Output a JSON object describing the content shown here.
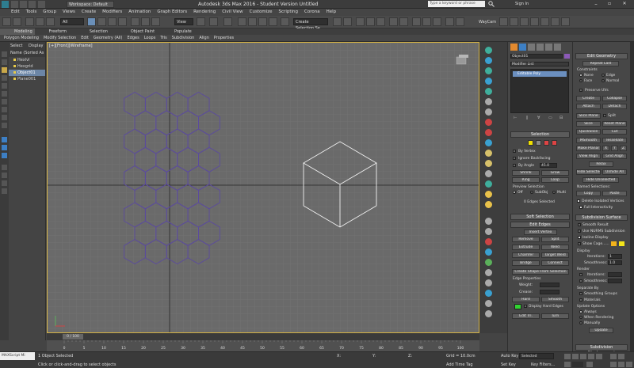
{
  "window": {
    "workspace": "Workspace: Default",
    "title": "Autodesk 3ds Max 2016 - Student Version    Untitled",
    "search_placeholder": "Type a keyword or phrase",
    "signin": "Sign In"
  },
  "menu": [
    "Edit",
    "Tools",
    "Group",
    "Views",
    "Create",
    "Modifiers",
    "Animation",
    "Graph Editors",
    "Rendering",
    "Civil View",
    "Customize",
    "Scripting",
    "Corona",
    "Help"
  ],
  "toolbar": {
    "filter": "All",
    "view": "View",
    "selset": "Create Selection Se",
    "render_label": "WayCam"
  },
  "ribbon_tabs": [
    "Modeling",
    "Freeform",
    "Selection",
    "Object Paint",
    "Populate"
  ],
  "ribbon_tools": [
    "Polygon Modeling",
    "Modify Selection",
    "Edit",
    "Geometry (All)",
    "Edges",
    "Loops",
    "Tris",
    "Subdivision",
    "Align",
    "Properties"
  ],
  "scene_explorer": {
    "tabs": [
      "Select",
      "Display"
    ],
    "header": "Name (Sorted As",
    "items": [
      {
        "name": "Hexlvl",
        "selected": false
      },
      {
        "name": "Hexgrid",
        "selected": false
      },
      {
        "name": "Object01",
        "selected": true
      },
      {
        "name": "Plane001",
        "selected": false
      }
    ]
  },
  "viewport": {
    "label": "[+][Front][Wireframe]"
  },
  "timeline": {
    "frame": "0 / 100"
  },
  "ticks": [
    "0",
    "5",
    "10",
    "15",
    "20",
    "25",
    "30",
    "35",
    "40",
    "45",
    "50",
    "55",
    "60",
    "65",
    "70",
    "75",
    "80",
    "85",
    "90",
    "95",
    "100"
  ],
  "status": {
    "message": "1 Object Selected",
    "prompt": "Click or click-and-drag to select objects",
    "maxscript": "MAXScript Mi",
    "x": "X:",
    "y": "Y:",
    "z": "Z:",
    "grid": "Grid = 10.0cm",
    "autokey": "Auto Key",
    "setkey": "Set Key",
    "selected": "Selected",
    "keyfilters": "Key Filters...",
    "addtimetag": "Add Time Tag"
  },
  "modifier_panel": {
    "object_name": "Object01",
    "modifier_list": "Modifier List",
    "stack_item": "Editable Poly",
    "selection_title": "Selection",
    "by_vertex": "By Vertex",
    "ignore_backfacing": "Ignore Backfacing",
    "by_angle": "By Angle",
    "angle_value": "45.0",
    "shrink": "Shrink",
    "grow": "Grow",
    "ring": "Ring",
    "loop": "Loop",
    "preview_selection": "Preview Selection",
    "off": "Off",
    "subobj": "SubObj",
    "multi": "Multi",
    "edges_selected": "0 Edges Selected",
    "soft_selection": "Soft Selection",
    "edit_edges": "Edit Edges",
    "insert_vertex": "Insert Vertex",
    "remove": "Remove",
    "split": "Split",
    "extrude": "Extrude",
    "weld": "Weld",
    "chamfer": "Chamfer",
    "target_weld": "Target Weld",
    "bridge": "Bridge",
    "connect": "Connect",
    "create_shape": "Create Shape From Selection",
    "edge_properties": "Edge Properties",
    "weight": "Weight:",
    "crease": "Crease:",
    "hard": "Hard",
    "smooth": "Smooth",
    "display_hard_edges": "Display Hard Edges",
    "edit_tri": "Edit Tri.",
    "turn": "Turn"
  },
  "edit_panel": {
    "edit_geometry": "Edit Geometry",
    "repeat_last": "Repeat Last",
    "constraints": "Constraints",
    "none": "None",
    "edge": "Edge",
    "face": "Face",
    "normal": "Normal",
    "preserve_uvs": "Preserve UVs",
    "create": "Create",
    "collapse": "Collapse",
    "attach": "Attach",
    "detach": "Detach",
    "slice_plane": "Slice Plane",
    "split": "Split",
    "slice": "Slice",
    "reset_plane": "Reset Plane",
    "quickslice": "QuickSlice",
    "cut": "Cut",
    "msmooth": "MSmooth",
    "tessellate": "Tessellate",
    "make_planar": "Make Planar",
    "x": "X",
    "y": "Y",
    "z": "Z",
    "view_align": "View Align",
    "grid_align": "Grid Align",
    "relax": "Relax",
    "hide_selected": "Hide Selected",
    "unhide_all": "Unhide All",
    "hide_unselected": "Hide Unselected",
    "named_selections": "Named Selections:",
    "copy": "Copy",
    "paste": "Paste",
    "delete_isolated": "Delete Isolated Vertices",
    "full_interactivity": "Full Interactivity",
    "subdivision_surface": "Subdivision Surface",
    "smooth_result": "Smooth Result",
    "use_nurms": "Use NURMS Subdivision",
    "isoline": "Isoline Display",
    "show_cage": "Show Cage......",
    "display": "Display",
    "iterations": "Iterations:",
    "iter_val": "1",
    "smoothness": "Smoothness:",
    "smooth_val": "1.0",
    "render": "Render",
    "separate_by": "Separate By",
    "smoothing_groups": "Smoothing Groups",
    "materials": "Materials",
    "update_options": "Update Options",
    "always": "Always",
    "when_rendering": "When Rendering",
    "manually": "Manually",
    "update": "Update",
    "subdiv_displacement": "Subdivision Displacement"
  },
  "colors": {
    "viewport_bg": "#6a6a6a",
    "hex_stroke": "#5b4a9e",
    "cube_stroke": "#f0f0f0",
    "active_border": "#d4b243"
  }
}
